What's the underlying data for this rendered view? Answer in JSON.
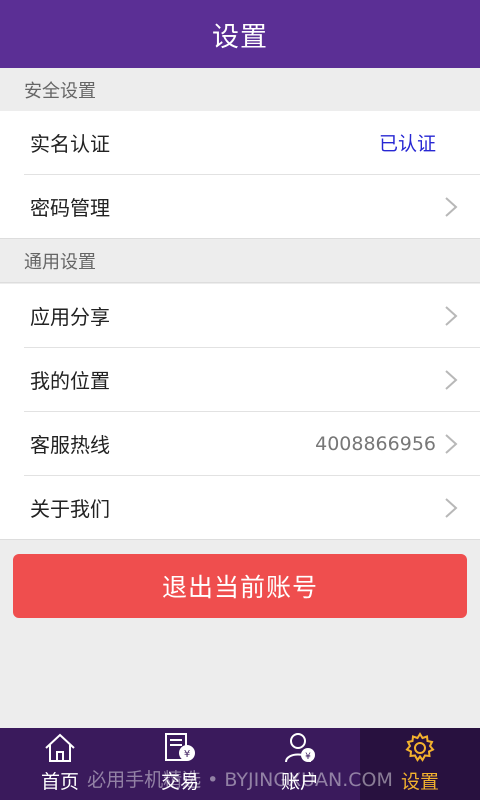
{
  "header": {
    "title": "设置"
  },
  "sections": {
    "security": {
      "title": "安全设置",
      "items": [
        {
          "label": "实名认证",
          "value": "已认证"
        },
        {
          "label": "密码管理"
        }
      ]
    },
    "general": {
      "title": "通用设置",
      "items": [
        {
          "label": "应用分享"
        },
        {
          "label": "我的位置"
        },
        {
          "label": "客服热线",
          "value": "4008866956"
        },
        {
          "label": "关于我们"
        }
      ]
    }
  },
  "logout": {
    "label": "退出当前账号"
  },
  "tabbar": {
    "tabs": [
      {
        "label": "首页",
        "icon": "home-icon"
      },
      {
        "label": "交易",
        "icon": "trade-icon"
      },
      {
        "label": "账户",
        "icon": "account-icon"
      },
      {
        "label": "设置",
        "icon": "gear-icon",
        "active": true
      }
    ]
  },
  "watermark": "必用手机精选 • BYJINGXUAN.COM",
  "colors": {
    "header_bg": "#5b2f95",
    "tabbar_bg": "#3a1a5c",
    "active_tab": "#f3b22e",
    "logout_bg": "#ef4e4e",
    "verified": "#2727d3"
  }
}
